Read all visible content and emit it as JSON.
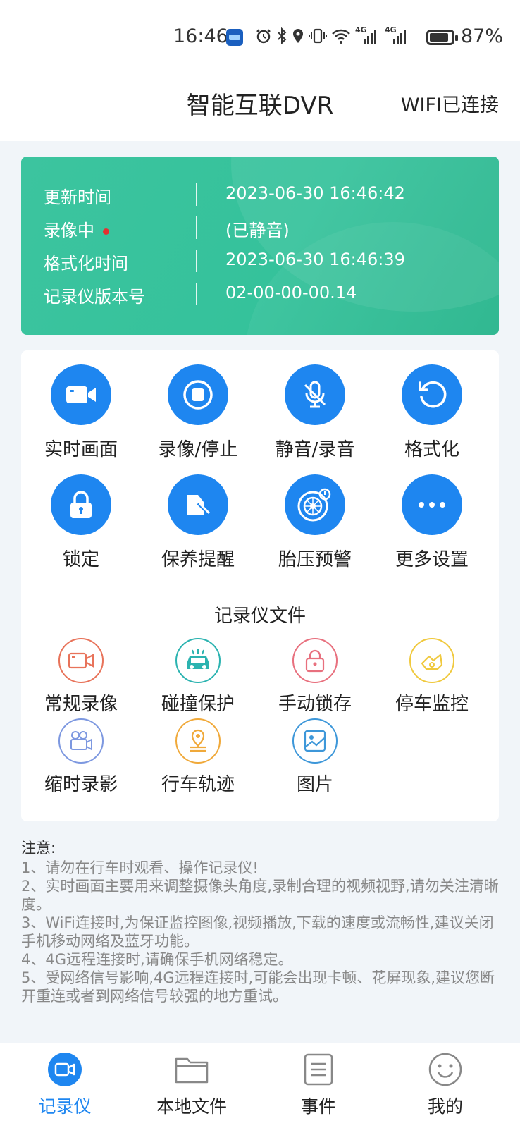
{
  "status_bar": {
    "time": "16:46",
    "icons": [
      "app-icon",
      "alarm-icon",
      "bluetooth-icon",
      "location-icon",
      "vibrate-icon",
      "wifi-icon",
      "signal-4g-icon",
      "signal-4g-icon",
      "battery-icon"
    ],
    "signal1": "4G",
    "signal2": "4G",
    "battery": "87%"
  },
  "header": {
    "title": "智能互联DVR",
    "wifi_status": "WIFI已连接"
  },
  "info_card": {
    "rows": [
      {
        "label": "更新时间",
        "value": "2023-06-30 16:46:42"
      },
      {
        "label": "录像中",
        "value": "(已静音)"
      },
      {
        "label": "格式化时间",
        "value": "2023-06-30 16:46:39"
      },
      {
        "label": "记录仪版本号",
        "value": "02-00-00-00.14"
      }
    ],
    "accent": "#35c29b",
    "recording_dot_color": "#e53030"
  },
  "functions": [
    {
      "label": "实时画面",
      "icon": "camera-icon"
    },
    {
      "label": "录像/停止",
      "icon": "stop-icon"
    },
    {
      "label": "静音/录音",
      "icon": "mic-off-icon"
    },
    {
      "label": "格式化",
      "icon": "refresh-icon"
    },
    {
      "label": "锁定",
      "icon": "lock-icon"
    },
    {
      "label": "保养提醒",
      "icon": "maintenance-icon"
    },
    {
      "label": "胎压预警",
      "icon": "tire-icon"
    },
    {
      "label": "更多设置",
      "icon": "more-icon"
    }
  ],
  "function_color": "#1e86f0",
  "files": {
    "title": "记录仪文件",
    "items": [
      {
        "label": "常规录像",
        "icon": "video-icon",
        "color": "#e8735a"
      },
      {
        "label": "碰撞保护",
        "icon": "collision-icon",
        "color": "#2bb3b0"
      },
      {
        "label": "手动锁存",
        "icon": "lock-icon",
        "color": "#e8707e"
      },
      {
        "label": "停车监控",
        "icon": "parking-icon",
        "color": "#f0c93e"
      },
      {
        "label": "缩时录影",
        "icon": "timelapse-icon",
        "color": "#7d98e0"
      },
      {
        "label": "行车轨迹",
        "icon": "track-icon",
        "color": "#f0a93a"
      },
      {
        "label": "图片",
        "icon": "picture-icon",
        "color": "#3d97d9"
      }
    ]
  },
  "notice": {
    "title": "注意:",
    "lines": [
      "1、请勿在行车时观看、操作记录仪!",
      "2、实时画面主要用来调整摄像头角度,录制合理的视频视野,请勿关注清晰度。",
      "3、WiFi连接时,为保证监控图像,视频播放,下载的速度或流畅性,建议关闭手机移动网络及蓝牙功能。",
      "4、4G远程连接时,请确保手机网络稳定。",
      "5、受网络信号影响,4G远程连接时,可能会出现卡顿、花屏现象,建议您断开重连或者到网络信号较强的地方重试。"
    ]
  },
  "bottom_nav": [
    {
      "label": "记录仪",
      "icon": "recorder-icon",
      "active": true
    },
    {
      "label": "本地文件",
      "icon": "folder-icon",
      "active": false
    },
    {
      "label": "事件",
      "icon": "list-icon",
      "active": false
    },
    {
      "label": "我的",
      "icon": "smile-icon",
      "active": false
    }
  ]
}
